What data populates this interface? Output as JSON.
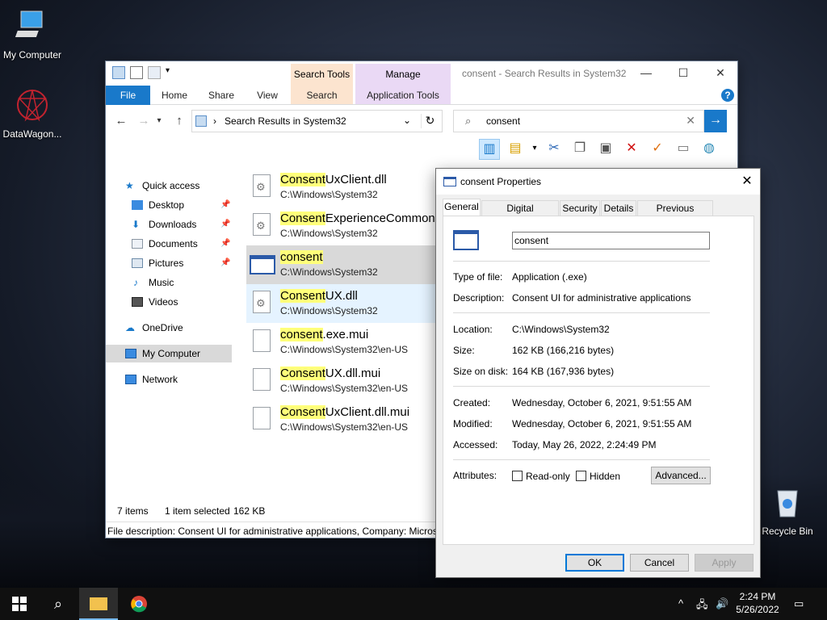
{
  "desktop": {
    "icons": [
      {
        "label": "My Computer",
        "icon": "monitor-icon"
      },
      {
        "label": "DataWagon...",
        "icon": "datawagon-logo-icon"
      },
      {
        "label": "Recycle Bin",
        "icon": "recycle-bin-icon"
      }
    ]
  },
  "explorer": {
    "title": "consent - Search Results in System32",
    "context_tabs": {
      "search_tools": "Search Tools",
      "manage": "Manage"
    },
    "ribbon_tabs": [
      "File",
      "Home",
      "Share",
      "View",
      "Search",
      "Application Tools"
    ],
    "address": "Search Results in System32",
    "search_value": "consent",
    "nav": {
      "quick_access": "Quick access",
      "items": [
        "Desktop",
        "Downloads",
        "Documents",
        "Pictures",
        "Music",
        "Videos"
      ],
      "onedrive": "OneDrive",
      "my_computer": "My Computer",
      "network": "Network"
    },
    "files": [
      {
        "hl": "Consent",
        "rest": "UxClient.dll",
        "path": "C:\\Windows\\System32"
      },
      {
        "hl": "Consent",
        "rest": "ExperienceCommon.d",
        "path": "C:\\Windows\\System32"
      },
      {
        "hl": "consent",
        "rest": "",
        "path": "C:\\Windows\\System32"
      },
      {
        "hl": "Consent",
        "rest": "UX.dll",
        "path": "C:\\Windows\\System32"
      },
      {
        "hl": "consent",
        "rest": ".exe.mui",
        "path": "C:\\Windows\\System32\\en-US"
      },
      {
        "hl": "Consent",
        "rest": "UX.dll.mui",
        "path": "C:\\Windows\\System32\\en-US"
      },
      {
        "hl": "Consent",
        "rest": "UxClient.dll.mui",
        "path": "C:\\Windows\\System32\\en-US"
      }
    ],
    "status": {
      "count": "7 items",
      "selected": "1 item selected",
      "size": "162 KB"
    },
    "description_bar": "File description: Consent UI for administrative applications, Company: Micros"
  },
  "dialog": {
    "title": "consent Properties",
    "tabs": [
      "General",
      "Digital Signatures",
      "Security",
      "Details",
      "Previous Versions"
    ],
    "name": "consent",
    "type_label": "Type of file:",
    "type_value": "Application (.exe)",
    "desc_label": "Description:",
    "desc_value": "Consent UI for administrative applications",
    "location_label": "Location:",
    "location_value": "C:\\Windows\\System32",
    "size_label": "Size:",
    "size_value": "162 KB (166,216 bytes)",
    "disk_label": "Size on disk:",
    "disk_value": "164 KB (167,936 bytes)",
    "created_label": "Created:",
    "created_value": "Wednesday, October 6, 2021, 9:51:55 AM",
    "modified_label": "Modified:",
    "modified_value": "Wednesday, October 6, 2021, 9:51:55 AM",
    "accessed_label": "Accessed:",
    "accessed_value": "Today, May 26, 2022, 2:24:49 PM",
    "attributes_label": "Attributes:",
    "readonly_label": "Read-only",
    "hidden_label": "Hidden",
    "advanced_label": "Advanced...",
    "ok": "OK",
    "cancel": "Cancel",
    "apply": "Apply"
  },
  "taskbar": {
    "time": "2:24 PM",
    "date": "5/26/2022"
  }
}
